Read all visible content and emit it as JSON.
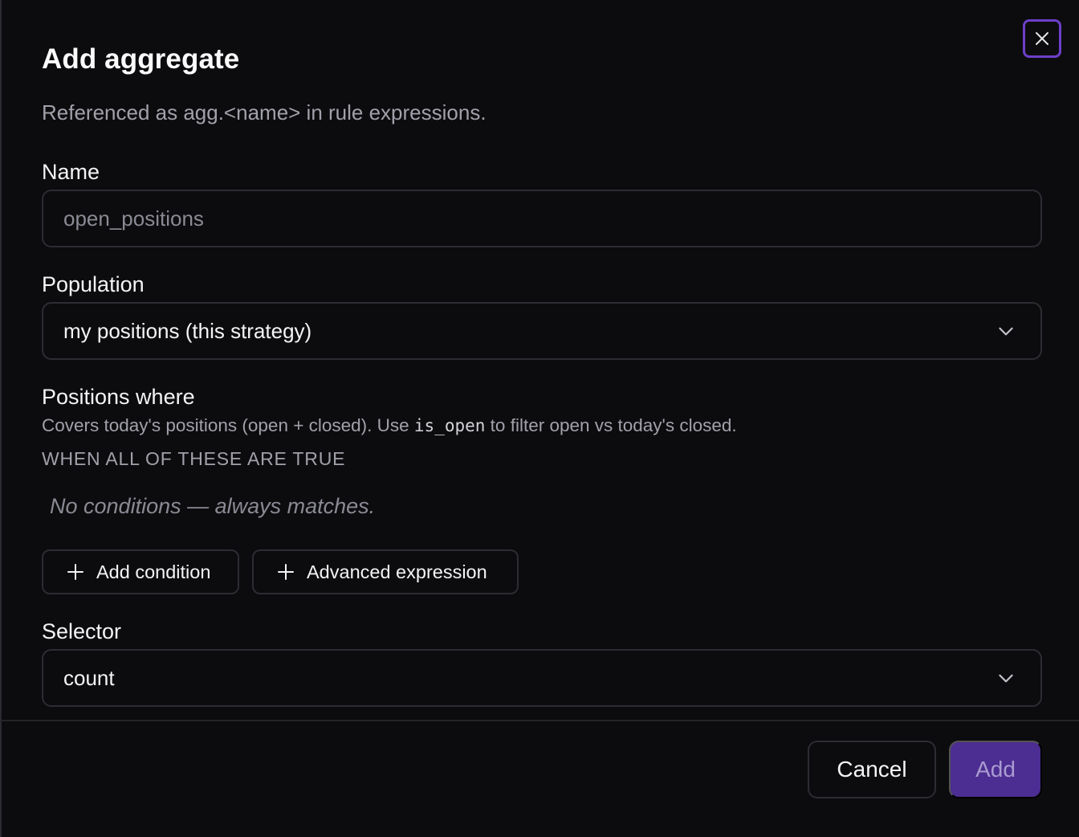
{
  "dialog": {
    "title": "Add aggregate",
    "subtitle": "Referenced as agg.<name> in rule expressions.",
    "close_icon": "close-icon"
  },
  "name_field": {
    "label": "Name",
    "placeholder": "open_positions",
    "value": ""
  },
  "population_field": {
    "label": "Population",
    "value": "my positions (this strategy)",
    "icon": "chevron-down-icon"
  },
  "positions_where": {
    "label": "Positions where",
    "help_before": "Covers today's positions (open + closed). Use ",
    "help_code": "is_open",
    "help_after": " to filter open vs today's closed.",
    "caption": "WHEN ALL OF THESE ARE TRUE",
    "empty_text": "No conditions — always matches.",
    "add_condition_label": "Add condition",
    "advanced_expression_label": "Advanced expression"
  },
  "selector_field": {
    "label": "Selector",
    "value": "count",
    "icon": "chevron-down-icon"
  },
  "footer": {
    "cancel_label": "Cancel",
    "add_label": "Add"
  },
  "colors": {
    "background": "#0c0c0f",
    "accent": "#6d3fc9",
    "primary_button": "#4c2d91"
  }
}
